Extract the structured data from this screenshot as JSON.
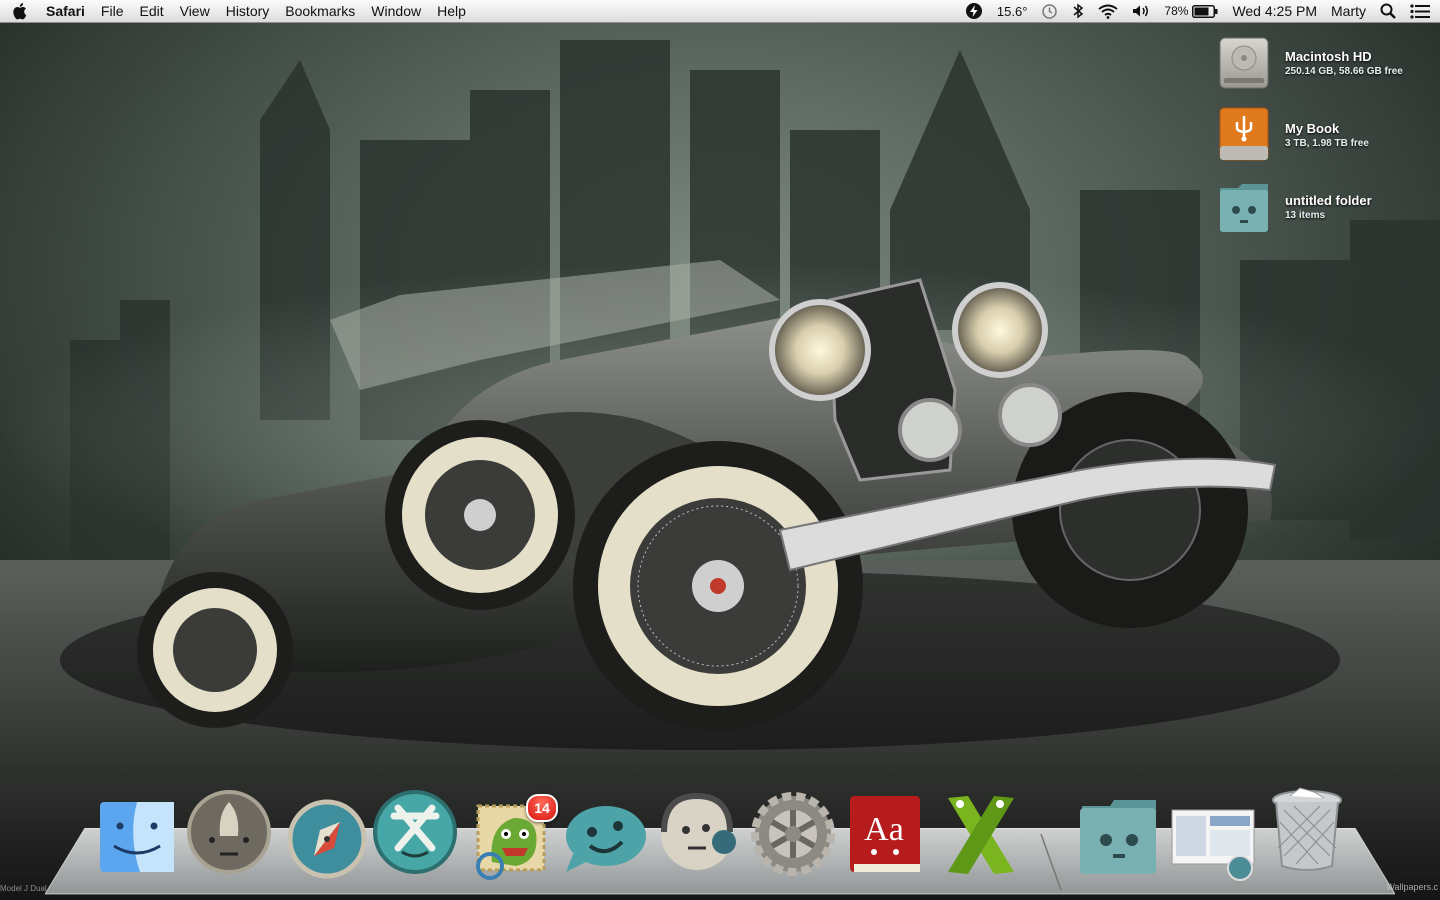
{
  "menubar": {
    "app_name": "Safari",
    "menus": [
      "File",
      "Edit",
      "View",
      "History",
      "Bookmarks",
      "Window",
      "Help"
    ],
    "status": {
      "temperature": "15.6°",
      "battery": "78%",
      "clock": "Wed 4:25 PM",
      "user": "Marty"
    },
    "icons": [
      "bolt-icon",
      "time-machine-icon",
      "bluetooth-icon",
      "wifi-icon",
      "volume-icon",
      "battery-icon",
      "spotlight-icon",
      "notification-list-icon"
    ]
  },
  "desktop": {
    "items": [
      {
        "name": "Macintosh HD",
        "info": "250.14 GB, 58.66 GB free",
        "icon": "hard-drive-icon"
      },
      {
        "name": "My Book",
        "info": "3 TB, 1.98 TB free",
        "icon": "usb-drive-icon"
      },
      {
        "name": "untitled folder",
        "info": "13 items",
        "icon": "folder-icon"
      }
    ]
  },
  "dock": {
    "apps": [
      {
        "name": "Finder",
        "icon": "finder-icon"
      },
      {
        "name": "Launchpad",
        "icon": "launchpad-icon"
      },
      {
        "name": "Safari",
        "icon": "safari-icon"
      },
      {
        "name": "App Store",
        "icon": "app-store-icon"
      },
      {
        "name": "Mail",
        "icon": "mail-icon",
        "badge": "14"
      },
      {
        "name": "Messages",
        "icon": "messages-icon"
      },
      {
        "name": "iTunes",
        "icon": "itunes-icon"
      },
      {
        "name": "System Preferences",
        "icon": "system-preferences-icon"
      },
      {
        "name": "Dictionary",
        "icon": "dictionary-icon",
        "label": "Aa"
      },
      {
        "name": "Xcode",
        "icon": "xcode-icon"
      }
    ],
    "right": [
      {
        "name": "Folder stack",
        "icon": "folder-stack-icon"
      },
      {
        "name": "Screenshot stack",
        "icon": "screenshot-stack-icon"
      },
      {
        "name": "Trash",
        "icon": "trash-icon"
      }
    ]
  },
  "wallpaper": {
    "credit_left": "Model J Dual",
    "credit_right": "Wallpapers.c"
  }
}
